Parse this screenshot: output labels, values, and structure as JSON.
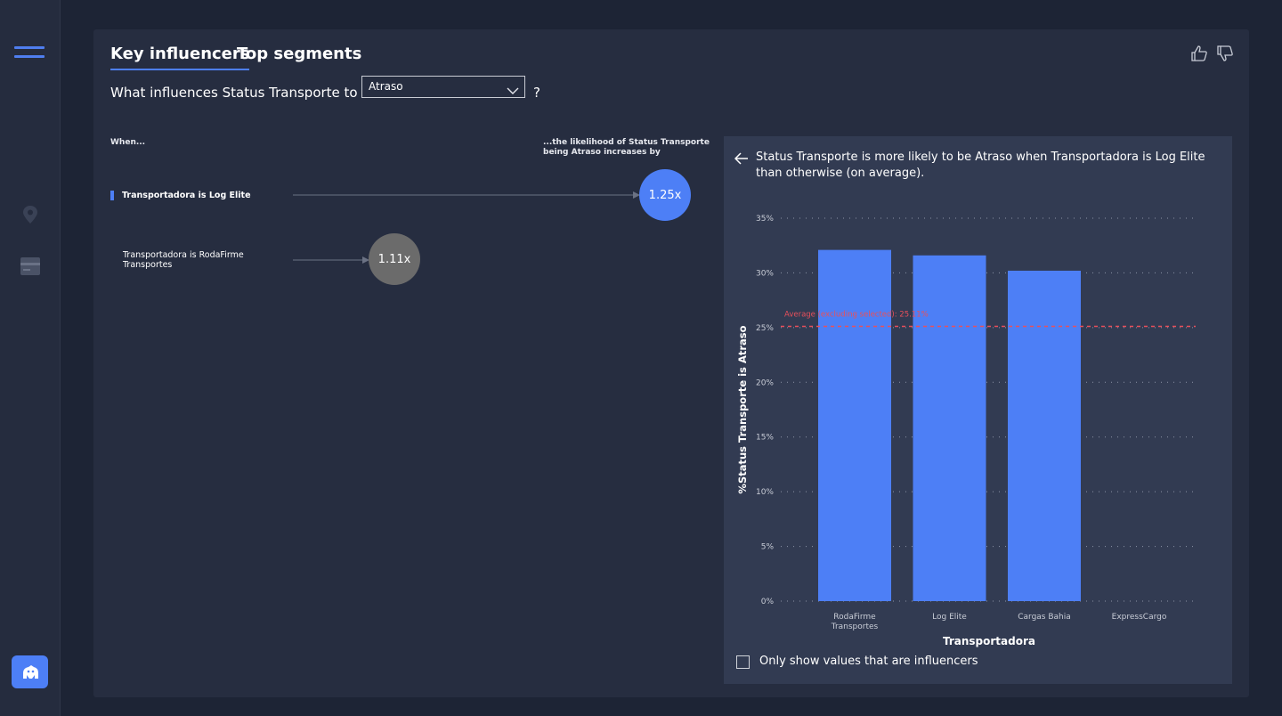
{
  "tabs": [
    {
      "label": "Key influencers"
    },
    {
      "label": "Top segments"
    }
  ],
  "question": {
    "prefix": "What influences Status Transporte to be",
    "selected_value": "Atraso",
    "suffix": "?"
  },
  "left": {
    "when_label": "When...",
    "likelihood_label_1": "...the likelihood of Status Transporte",
    "likelihood_label_2": "being Atraso increases by",
    "influencers": [
      {
        "label_lines": [
          "Transportadora is Log Elite"
        ],
        "value": "1.25x",
        "selected": true,
        "color": "#4d7ff6"
      },
      {
        "label_lines": [
          "Transportadora is RodaFirme",
          "Transportes"
        ],
        "value": "1.11x",
        "selected": false,
        "color": "#6b6b6b"
      }
    ]
  },
  "detail": {
    "title": "Status Transporte is more likely to be Atraso when Transportadora is Log Elite than otherwise (on average).",
    "checkbox_label": "Only show values that are influencers",
    "checkbox_checked": false
  },
  "chart_data": {
    "type": "bar",
    "categories": [
      "RodaFirme Transportes",
      "Log Elite",
      "Cargas Bahia",
      "ExpressCargo"
    ],
    "values": [
      32.1,
      31.6,
      30.2,
      0
    ],
    "xlabel": "Transportadora",
    "ylabel": "%Status Transporte is Atraso",
    "ylim": [
      0,
      35
    ],
    "yticks": [
      "0%",
      "5%",
      "10%",
      "15%",
      "20%",
      "25%",
      "30%",
      "35%"
    ],
    "bar_color": "#4d7ff6",
    "grid": true,
    "reference_line": {
      "label": "Average (excluding selected): 25.11%",
      "value": 25.11,
      "color": "#e8505b"
    }
  }
}
